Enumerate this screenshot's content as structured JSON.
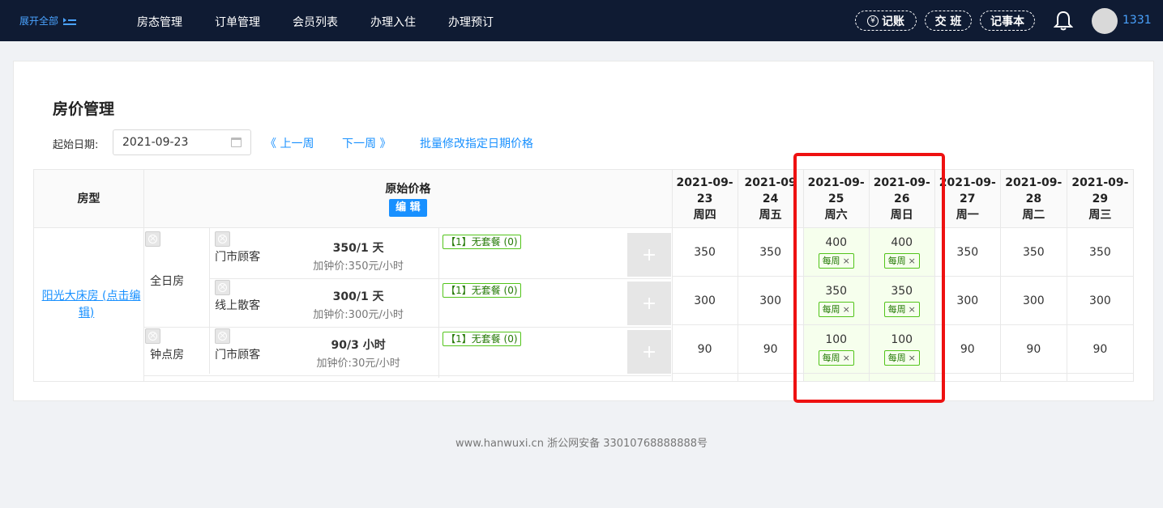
{
  "topbar": {
    "expand_label": "展开全部",
    "nav": [
      "房态管理",
      "订单管理",
      "会员列表",
      "办理入住",
      "办理预订"
    ],
    "bookkeep_label": "记账",
    "yen_symbol": "¥",
    "shift_label": "交 班",
    "notepad_label": "记事本",
    "username": "1331"
  },
  "page": {
    "title": "房价管理",
    "start_date_label": "起始日期:",
    "start_date_value": "2021-09-23",
    "prev_week": "《 上一周",
    "next_week": "下一周 》",
    "batch_edit": "批量修改指定日期价格"
  },
  "table": {
    "col_room_type": "房型",
    "col_base_price": "原始价格",
    "edit_label": "编 辑",
    "dates": [
      {
        "d1": "2021-09-",
        "d2": "23",
        "wd": "周四"
      },
      {
        "d1": "2021-09",
        "d2": "24",
        "wd": "周五"
      },
      {
        "d1": "2021-09-",
        "d2": "25",
        "wd": "周六"
      },
      {
        "d1": "2021-09-",
        "d2": "26",
        "wd": "周日"
      },
      {
        "d1": "2021-09-",
        "d2": "27",
        "wd": "周一"
      },
      {
        "d1": "2021-09-",
        "d2": "28",
        "wd": "周二"
      },
      {
        "d1": "2021-09-",
        "d2": "29",
        "wd": "周三"
      }
    ],
    "room_name": "阳光大床房 (点击编辑)",
    "rate_types": [
      "全日房",
      "钟点房"
    ],
    "rows": [
      {
        "customer": "门市顾客",
        "price": "350/1 天",
        "add_price": "加钟价:350元/小时",
        "package": "【1】无套餐 (0)",
        "values": [
          "350",
          "350",
          "400",
          "400",
          "350",
          "350",
          "350"
        ]
      },
      {
        "customer": "线上散客",
        "price": "300/1 天",
        "add_price": "加钟价:300元/小时",
        "package": "【1】无套餐 (0)",
        "values": [
          "300",
          "300",
          "350",
          "350",
          "300",
          "300",
          "300"
        ]
      },
      {
        "customer": "门市顾客",
        "price": "90/3 小时",
        "add_price": "加钟价:30元/小时",
        "package": "【1】无套餐 (0)",
        "values": [
          "90",
          "90",
          "100",
          "100",
          "90",
          "90",
          "90"
        ]
      }
    ],
    "weekly_tag": "每周",
    "tag_close": "×",
    "plus": "+"
  },
  "footer": "www.hanwuxi.cn  浙公网安备 33010768888888号",
  "colors": {
    "topbar_bg": "#0f1b33",
    "accent": "#1890ff",
    "weekend_bg": "#f6ffed",
    "tag_green": "#52c41a",
    "highlight_red": "#ee1111"
  }
}
